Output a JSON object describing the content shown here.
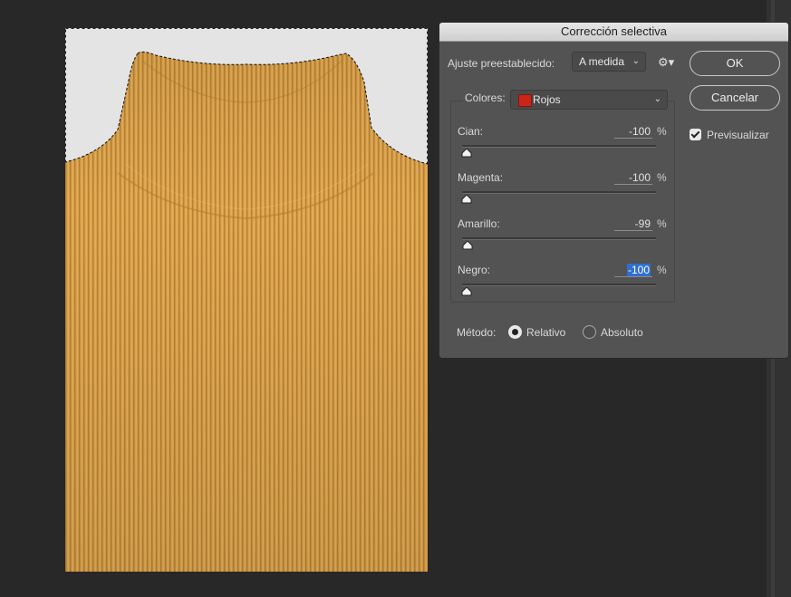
{
  "dialog": {
    "title": "Corrección selectiva",
    "preset_label": "Ajuste preestablecido:",
    "preset_value": "A medida",
    "gear_icon": "gear-icon",
    "ok_label": "OK",
    "cancel_label": "Cancelar",
    "preview_label": "Previsualizar",
    "preview_checked": true,
    "colors_label": "Colores:",
    "colors_value": "Rojos",
    "colors_swatch": "#cc2517",
    "sliders": [
      {
        "label": "Cian:",
        "value": "-100",
        "unit": "%",
        "level": -100
      },
      {
        "label": "Magenta:",
        "value": "-100",
        "unit": "%",
        "level": -100
      },
      {
        "label": "Amarillo:",
        "value": "-99",
        "unit": "%",
        "level": -99
      },
      {
        "label": "Negro:",
        "value": "-100",
        "unit": "%",
        "level": -100,
        "selected": true
      }
    ],
    "method_label": "Método:",
    "method_options": [
      {
        "label": "Relativo",
        "checked": true
      },
      {
        "label": "Absoluto",
        "checked": false
      }
    ]
  },
  "canvas": {
    "background": "#e4e4e4",
    "garment_color": "#d9a04a"
  }
}
